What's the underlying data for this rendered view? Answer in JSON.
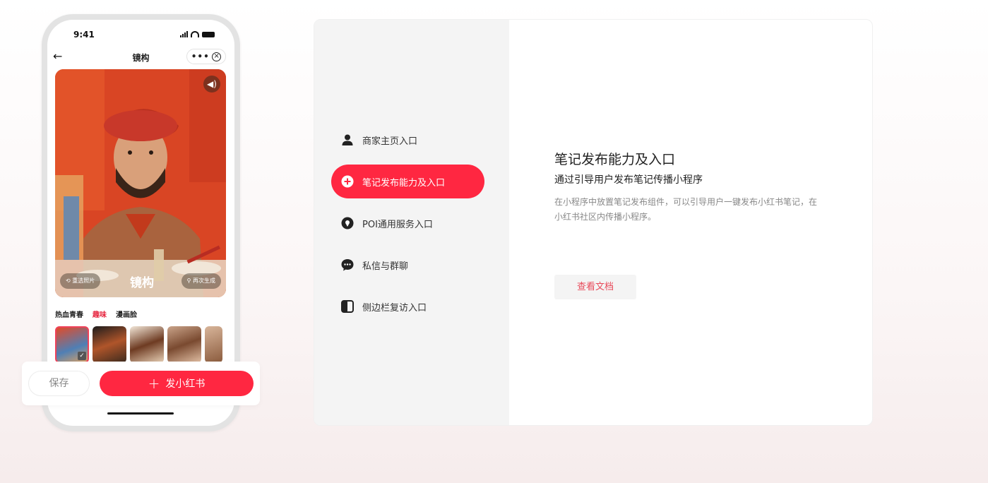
{
  "phone": {
    "time": "9:41",
    "nav_title": "镜构",
    "back_glyph": "←",
    "more_glyph": "•••",
    "close_glyph": "×",
    "sound_glyph": "◀)",
    "reselect_label": "⟲ 重选照片",
    "regenerate_label": "⚲ 再次生成",
    "logo_text": "镜构",
    "style_tabs": [
      "热血青春",
      "趣味",
      "漫画脸"
    ],
    "active_style": "趣味",
    "save_label": "保存",
    "post_plus": "+",
    "post_label": "发小红书",
    "check_glyph": "✓"
  },
  "panel": {
    "menu": [
      {
        "label": "商家主页入口",
        "icon": "user-icon"
      },
      {
        "label": "笔记发布能力及入口",
        "icon": "plus-circle-icon"
      },
      {
        "label": "POI通用服务入口",
        "icon": "location-pin-icon"
      },
      {
        "label": "私信与群聊",
        "icon": "chat-bubble-icon"
      },
      {
        "label": "侧边栏复访入口",
        "icon": "sidebar-toggle-icon"
      }
    ],
    "active_index": 1,
    "title": "笔记发布能力及入口",
    "subtitle": "通过引导用户发布笔记传播小程序",
    "description": "在小程序中放置笔记发布组件，可以引导用户一键发布小红书笔记，在小红书社区内传播小程序。",
    "docs_button": "查看文档"
  },
  "colors": {
    "brand": "#ff2741",
    "docs_text": "#e84a5a"
  }
}
